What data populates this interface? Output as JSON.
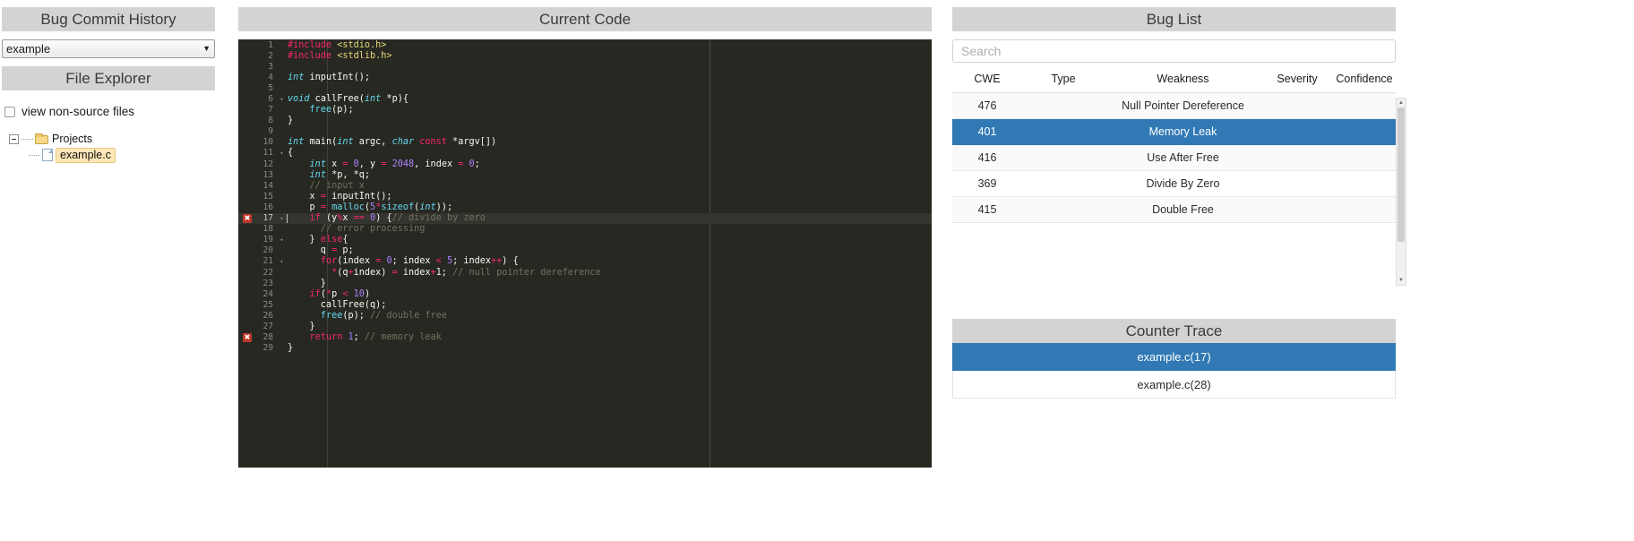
{
  "left": {
    "commit_history_title": "Bug Commit History",
    "commit_select_value": "example",
    "file_explorer_title": "File Explorer",
    "view_non_source_label": "view non-source files",
    "tree": {
      "root_label": "Projects",
      "file_label": "example.c"
    }
  },
  "center": {
    "title": "Current Code",
    "code_lines": [
      {
        "n": "1",
        "fold": "",
        "err": false,
        "tokens": [
          {
            "t": "#include ",
            "c": "t-pre"
          },
          {
            "t": "<stdio.h>",
            "c": "t-str"
          }
        ]
      },
      {
        "n": "2",
        "fold": "",
        "err": false,
        "tokens": [
          {
            "t": "#include ",
            "c": "t-pre"
          },
          {
            "t": "<stdlib.h>",
            "c": "t-str"
          }
        ]
      },
      {
        "n": "3",
        "fold": "",
        "err": false,
        "tokens": []
      },
      {
        "n": "4",
        "fold": "",
        "err": false,
        "tokens": [
          {
            "t": "int",
            "c": "t-type"
          },
          {
            "t": " inputInt();",
            "c": ""
          }
        ]
      },
      {
        "n": "5",
        "fold": "",
        "err": false,
        "tokens": []
      },
      {
        "n": "6",
        "fold": "▾",
        "err": false,
        "tokens": [
          {
            "t": "void",
            "c": "t-type"
          },
          {
            "t": " callFree(",
            "c": ""
          },
          {
            "t": "int",
            "c": "t-type"
          },
          {
            "t": " *p){",
            "c": ""
          }
        ]
      },
      {
        "n": "7",
        "fold": "",
        "err": false,
        "tokens": [
          {
            "t": "    ",
            "c": ""
          },
          {
            "t": "free",
            "c": "t-cyan"
          },
          {
            "t": "(p);",
            "c": ""
          }
        ]
      },
      {
        "n": "8",
        "fold": "",
        "err": false,
        "tokens": [
          {
            "t": "}",
            "c": ""
          }
        ]
      },
      {
        "n": "9",
        "fold": "",
        "err": false,
        "tokens": []
      },
      {
        "n": "10",
        "fold": "",
        "err": false,
        "tokens": [
          {
            "t": "int",
            "c": "t-type"
          },
          {
            "t": " main(",
            "c": ""
          },
          {
            "t": "int",
            "c": "t-type"
          },
          {
            "t": " argc, ",
            "c": ""
          },
          {
            "t": "char",
            "c": "t-type"
          },
          {
            "t": " ",
            "c": ""
          },
          {
            "t": "const",
            "c": "t-kw"
          },
          {
            "t": " *argv[])",
            "c": ""
          }
        ]
      },
      {
        "n": "11",
        "fold": "▾",
        "err": false,
        "tokens": [
          {
            "t": "{",
            "c": ""
          }
        ]
      },
      {
        "n": "12",
        "fold": "",
        "err": false,
        "tokens": [
          {
            "t": "    ",
            "c": ""
          },
          {
            "t": "int",
            "c": "t-type"
          },
          {
            "t": " x ",
            "c": ""
          },
          {
            "t": "=",
            "c": "t-op"
          },
          {
            "t": " ",
            "c": ""
          },
          {
            "t": "0",
            "c": "t-num"
          },
          {
            "t": ", y ",
            "c": ""
          },
          {
            "t": "=",
            "c": "t-op"
          },
          {
            "t": " ",
            "c": ""
          },
          {
            "t": "2048",
            "c": "t-num"
          },
          {
            "t": ", index ",
            "c": ""
          },
          {
            "t": "=",
            "c": "t-op"
          },
          {
            "t": " ",
            "c": ""
          },
          {
            "t": "0",
            "c": "t-num"
          },
          {
            "t": ";",
            "c": ""
          }
        ]
      },
      {
        "n": "13",
        "fold": "",
        "err": false,
        "tokens": [
          {
            "t": "    ",
            "c": ""
          },
          {
            "t": "int",
            "c": "t-type"
          },
          {
            "t": " *p, *q;",
            "c": ""
          }
        ]
      },
      {
        "n": "14",
        "fold": "",
        "err": false,
        "tokens": [
          {
            "t": "    ",
            "c": ""
          },
          {
            "t": "// input x",
            "c": "t-cmt"
          }
        ]
      },
      {
        "n": "15",
        "fold": "",
        "err": false,
        "tokens": [
          {
            "t": "    x ",
            "c": ""
          },
          {
            "t": "=",
            "c": "t-op"
          },
          {
            "t": " inputInt();",
            "c": ""
          }
        ]
      },
      {
        "n": "16",
        "fold": "",
        "err": false,
        "tokens": [
          {
            "t": "    p ",
            "c": ""
          },
          {
            "t": "=",
            "c": "t-op"
          },
          {
            "t": " ",
            "c": ""
          },
          {
            "t": "malloc",
            "c": "t-cyan"
          },
          {
            "t": "(",
            "c": ""
          },
          {
            "t": "5",
            "c": "t-num"
          },
          {
            "t": "*",
            "c": "t-op"
          },
          {
            "t": "sizeof",
            "c": "t-cyan"
          },
          {
            "t": "(",
            "c": ""
          },
          {
            "t": "int",
            "c": "t-type"
          },
          {
            "t": "));",
            "c": ""
          }
        ]
      },
      {
        "n": "17",
        "fold": "▾",
        "err": true,
        "active": true,
        "tokens": [
          {
            "t": "    ",
            "c": ""
          },
          {
            "t": "if",
            "c": "t-kw"
          },
          {
            "t": " (y",
            "c": ""
          },
          {
            "t": "%",
            "c": "t-op"
          },
          {
            "t": "x ",
            "c": ""
          },
          {
            "t": "==",
            "c": "t-op"
          },
          {
            "t": " ",
            "c": ""
          },
          {
            "t": "0",
            "c": "t-num"
          },
          {
            "t": ") {",
            "c": ""
          },
          {
            "t": "// divide by zero",
            "c": "t-cmt"
          }
        ]
      },
      {
        "n": "18",
        "fold": "",
        "err": false,
        "tokens": [
          {
            "t": "      ",
            "c": ""
          },
          {
            "t": "// error processing",
            "c": "t-cmt"
          }
        ]
      },
      {
        "n": "19",
        "fold": "▾",
        "err": false,
        "tokens": [
          {
            "t": "    } ",
            "c": ""
          },
          {
            "t": "else",
            "c": "t-kw"
          },
          {
            "t": "{",
            "c": ""
          }
        ]
      },
      {
        "n": "20",
        "fold": "",
        "err": false,
        "tokens": [
          {
            "t": "      q ",
            "c": ""
          },
          {
            "t": "=",
            "c": "t-op"
          },
          {
            "t": " p;",
            "c": ""
          }
        ]
      },
      {
        "n": "21",
        "fold": "▾",
        "err": false,
        "tokens": [
          {
            "t": "      ",
            "c": ""
          },
          {
            "t": "for",
            "c": "t-kw"
          },
          {
            "t": "(index ",
            "c": ""
          },
          {
            "t": "=",
            "c": "t-op"
          },
          {
            "t": " ",
            "c": ""
          },
          {
            "t": "0",
            "c": "t-num"
          },
          {
            "t": "; index ",
            "c": ""
          },
          {
            "t": "<",
            "c": "t-op"
          },
          {
            "t": " ",
            "c": ""
          },
          {
            "t": "5",
            "c": "t-num"
          },
          {
            "t": "; index",
            "c": ""
          },
          {
            "t": "++",
            "c": "t-op"
          },
          {
            "t": ") {",
            "c": ""
          }
        ]
      },
      {
        "n": "22",
        "fold": "",
        "err": false,
        "tokens": [
          {
            "t": "        ",
            "c": ""
          },
          {
            "t": "*",
            "c": "t-op"
          },
          {
            "t": "(q",
            "c": ""
          },
          {
            "t": "+",
            "c": "t-op"
          },
          {
            "t": "index) ",
            "c": ""
          },
          {
            "t": "=",
            "c": "t-op"
          },
          {
            "t": " index",
            "c": ""
          },
          {
            "t": "+",
            "c": "t-op"
          },
          {
            "t": "1; ",
            "c": ""
          },
          {
            "t": "// null pointer dereference",
            "c": "t-cmt"
          }
        ]
      },
      {
        "n": "23",
        "fold": "",
        "err": false,
        "tokens": [
          {
            "t": "      }",
            "c": ""
          }
        ]
      },
      {
        "n": "24",
        "fold": "",
        "err": false,
        "tokens": [
          {
            "t": "    ",
            "c": ""
          },
          {
            "t": "if",
            "c": "t-kw"
          },
          {
            "t": "(",
            "c": ""
          },
          {
            "t": "*",
            "c": "t-op"
          },
          {
            "t": "p ",
            "c": ""
          },
          {
            "t": "<",
            "c": "t-op"
          },
          {
            "t": " ",
            "c": ""
          },
          {
            "t": "10",
            "c": "t-num"
          },
          {
            "t": ")",
            "c": ""
          }
        ]
      },
      {
        "n": "25",
        "fold": "",
        "err": false,
        "tokens": [
          {
            "t": "      callFree(q);",
            "c": ""
          }
        ]
      },
      {
        "n": "26",
        "fold": "",
        "err": false,
        "tokens": [
          {
            "t": "      ",
            "c": ""
          },
          {
            "t": "free",
            "c": "t-cyan"
          },
          {
            "t": "(p); ",
            "c": ""
          },
          {
            "t": "// double free",
            "c": "t-cmt"
          }
        ]
      },
      {
        "n": "27",
        "fold": "",
        "err": false,
        "tokens": [
          {
            "t": "    }",
            "c": ""
          }
        ]
      },
      {
        "n": "28",
        "fold": "",
        "err": true,
        "tokens": [
          {
            "t": "    ",
            "c": ""
          },
          {
            "t": "return",
            "c": "t-kw"
          },
          {
            "t": " ",
            "c": ""
          },
          {
            "t": "1",
            "c": "t-num"
          },
          {
            "t": "; ",
            "c": ""
          },
          {
            "t": "// memory leak",
            "c": "t-cmt"
          }
        ]
      },
      {
        "n": "29",
        "fold": "",
        "err": false,
        "tokens": [
          {
            "t": "}",
            "c": ""
          }
        ]
      }
    ],
    "error_marker_glyph": "✖"
  },
  "right": {
    "bug_list_title": "Bug List",
    "search_placeholder": "Search",
    "columns": [
      "CWE",
      "Type",
      "Weakness",
      "Severity",
      "Confidence"
    ],
    "rows": [
      {
        "cwe": "476",
        "type": "",
        "weakness": "Null Pointer Dereference",
        "severity": "",
        "confidence": "",
        "selected": false
      },
      {
        "cwe": "401",
        "type": "",
        "weakness": "Memory Leak",
        "severity": "",
        "confidence": "",
        "selected": true
      },
      {
        "cwe": "416",
        "type": "",
        "weakness": "Use After Free",
        "severity": "",
        "confidence": "",
        "selected": false
      },
      {
        "cwe": "369",
        "type": "",
        "weakness": "Divide By Zero",
        "severity": "",
        "confidence": "",
        "selected": false
      },
      {
        "cwe": "415",
        "type": "",
        "weakness": "Double Free",
        "severity": "",
        "confidence": "",
        "selected": false
      }
    ],
    "counter_trace_title": "Counter Trace",
    "trace_items": [
      {
        "label": "example.c(17)",
        "selected": true
      },
      {
        "label": "example.c(28)",
        "selected": false
      }
    ]
  },
  "colors": {
    "accent_blue": "#3179b4",
    "panel_header_grey": "#d3d3d3",
    "editor_bg": "#272822",
    "error_red": "#c0392b"
  }
}
